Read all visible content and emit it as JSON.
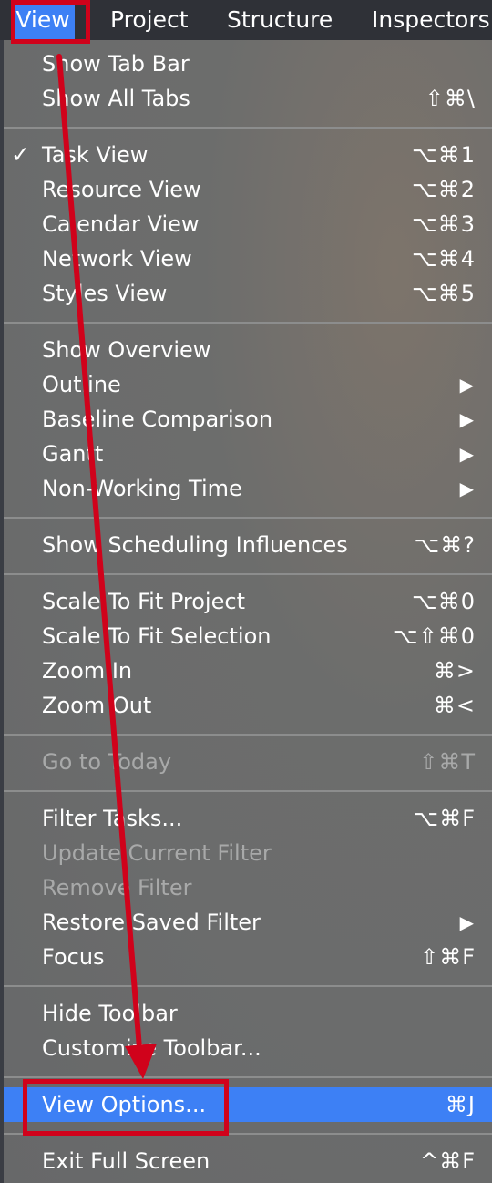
{
  "menubar": {
    "items": [
      "View",
      "Project",
      "Structure",
      "Inspectors"
    ]
  },
  "menu": {
    "show_tab_bar": {
      "label": "Show Tab Bar",
      "shortcut": ""
    },
    "show_all_tabs": {
      "label": "Show All Tabs",
      "shortcut": "⇧⌘\\"
    },
    "task_view": {
      "label": "Task View",
      "shortcut": "⌥⌘1",
      "check": "✓"
    },
    "resource_view": {
      "label": "Resource View",
      "shortcut": "⌥⌘2"
    },
    "calendar_view": {
      "label": "Calendar View",
      "shortcut": "⌥⌘3"
    },
    "network_view": {
      "label": "Network View",
      "shortcut": "⌥⌘4"
    },
    "styles_view": {
      "label": "Styles View",
      "shortcut": "⌥⌘5"
    },
    "show_overview": {
      "label": "Show Overview",
      "shortcut": ""
    },
    "outline": {
      "label": "Outline",
      "arrow": "▶"
    },
    "baseline_comparison": {
      "label": "Baseline Comparison",
      "arrow": "▶"
    },
    "gantt": {
      "label": "Gantt",
      "arrow": "▶"
    },
    "non_working_time": {
      "label": "Non-Working Time",
      "arrow": "▶"
    },
    "show_scheduling_influences": {
      "label": "Show Scheduling Influences",
      "shortcut": "⌥⌘?"
    },
    "scale_to_fit_project": {
      "label": "Scale To Fit Project",
      "shortcut": "⌥⌘0"
    },
    "scale_to_fit_selection": {
      "label": "Scale To Fit Selection",
      "shortcut": "⌥⇧⌘0"
    },
    "zoom_in": {
      "label": "Zoom In",
      "shortcut": "⌘>"
    },
    "zoom_out": {
      "label": "Zoom Out",
      "shortcut": "⌘<"
    },
    "go_to_today": {
      "label": "Go to Today",
      "shortcut": "⇧⌘T"
    },
    "filter_tasks": {
      "label": "Filter Tasks...",
      "shortcut": "⌥⌘F"
    },
    "update_current_filter": {
      "label": "Update Current Filter",
      "shortcut": ""
    },
    "remove_filter": {
      "label": "Remove Filter",
      "shortcut": ""
    },
    "restore_saved_filter": {
      "label": "Restore Saved Filter",
      "arrow": "▶"
    },
    "focus": {
      "label": "Focus",
      "shortcut": "⇧⌘F"
    },
    "hide_toolbar": {
      "label": "Hide Toolbar",
      "shortcut": ""
    },
    "customize_toolbar": {
      "label": "Customize Toolbar...",
      "shortcut": ""
    },
    "view_options": {
      "label": "View Options...",
      "shortcut": "⌘J"
    },
    "exit_full_screen": {
      "label": "Exit Full Screen",
      "shortcut": "^⌘F"
    }
  },
  "colors": {
    "menubar_bg": "#2f3137",
    "highlight": "#3d80f5",
    "annotation": "#d0021b",
    "disabled_text": "#a8a9a9"
  }
}
